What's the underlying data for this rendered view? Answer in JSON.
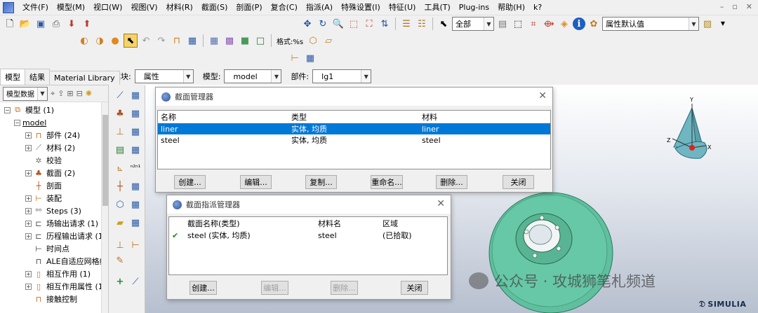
{
  "menu": {
    "items": [
      "文件(F)",
      "模型(M)",
      "视口(W)",
      "视图(V)",
      "材料(R)",
      "截面(S)",
      "剖面(P)",
      "复合(C)",
      "指派(A)",
      "特殊设置(I)",
      "特征(U)",
      "工具(T)",
      "Plug-ins",
      "帮助(H)",
      "k?"
    ]
  },
  "toolbar": {
    "select_filter": "全部",
    "attribute_default": "属性默认值",
    "format_label": "格式:%s"
  },
  "context": {
    "module_label": "模块:",
    "module_value": "属性",
    "model_label": "模型:",
    "model_value": "model",
    "part_label": "部件:",
    "part_value": "lg1"
  },
  "left_panel": {
    "tabs": [
      "模型",
      "结果",
      "Material Library"
    ],
    "tree_filter": "模型数据",
    "tree": [
      {
        "label": "模型 (1)"
      },
      {
        "label": "model"
      },
      {
        "label": "部件 (24)"
      },
      {
        "label": "材料 (2)"
      },
      {
        "label": "校验"
      },
      {
        "label": "截面 (2)"
      },
      {
        "label": "剖面"
      },
      {
        "label": "装配"
      },
      {
        "label": "Steps (3)"
      },
      {
        "label": "场输出请求 (1)"
      },
      {
        "label": "历程输出请求 (1"
      },
      {
        "label": "时间点"
      },
      {
        "label": "ALE自适应网格约"
      },
      {
        "label": "相互作用  (1)"
      },
      {
        "label": "相互作用属性 (1"
      },
      {
        "label": "接触控制"
      }
    ]
  },
  "section_manager": {
    "title": "截面管理器",
    "columns": [
      "名称",
      "类型",
      "材料"
    ],
    "rows": [
      {
        "name": "liner",
        "type": "实体, 均质",
        "material": "liner"
      },
      {
        "name": "steel",
        "type": "实体, 均质",
        "material": "steel"
      }
    ],
    "buttons": [
      "创建...",
      "编辑...",
      "复制...",
      "重命名...",
      "删除...",
      "关闭"
    ]
  },
  "assignment_manager": {
    "title": "截面指派管理器",
    "columns": [
      "截面名称(类型)",
      "材料名",
      "区域"
    ],
    "rows": [
      {
        "section": "steel (实体, 均质)",
        "material": "steel",
        "region": "(已拾取)"
      }
    ],
    "buttons": [
      "创建...",
      "编辑...",
      "删除...",
      "关闭"
    ]
  },
  "viewport": {
    "triad": {
      "x": "X",
      "y": "Y",
      "z": "Z"
    }
  },
  "watermark": "公众号 · 攻城狮笔札频道",
  "logo": "SIMULIA",
  "colors": {
    "selection": "#0078d7",
    "part_green": "#5fbf9f",
    "triad_teal": "#6fb6c0"
  }
}
